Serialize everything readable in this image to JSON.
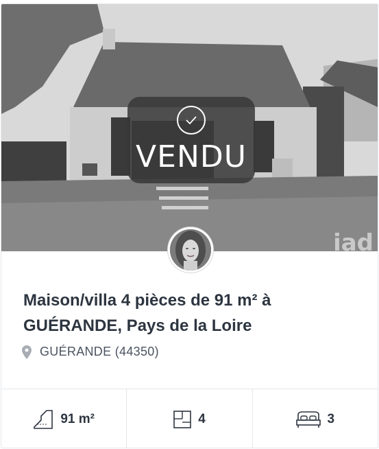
{
  "listing": {
    "status_label": "VENDU",
    "watermark": "iad",
    "title_line1": "Maison/villa 4 pièces de 91 m² à",
    "title_line2": "GUÉRANDE, Pays de la Loire",
    "location": "GUÉRANDE (44350)",
    "features": {
      "surface": "91 m²",
      "rooms": "4",
      "bedrooms": "3"
    }
  },
  "icons": {
    "check": "check-circle-icon",
    "pin": "map-pin-icon",
    "surface": "surface-area-icon",
    "rooms": "floor-plan-icon",
    "bedrooms": "bed-icon"
  },
  "colors": {
    "title": "#2d3540",
    "overlay": "#373737",
    "border": "#e4e7ec"
  }
}
